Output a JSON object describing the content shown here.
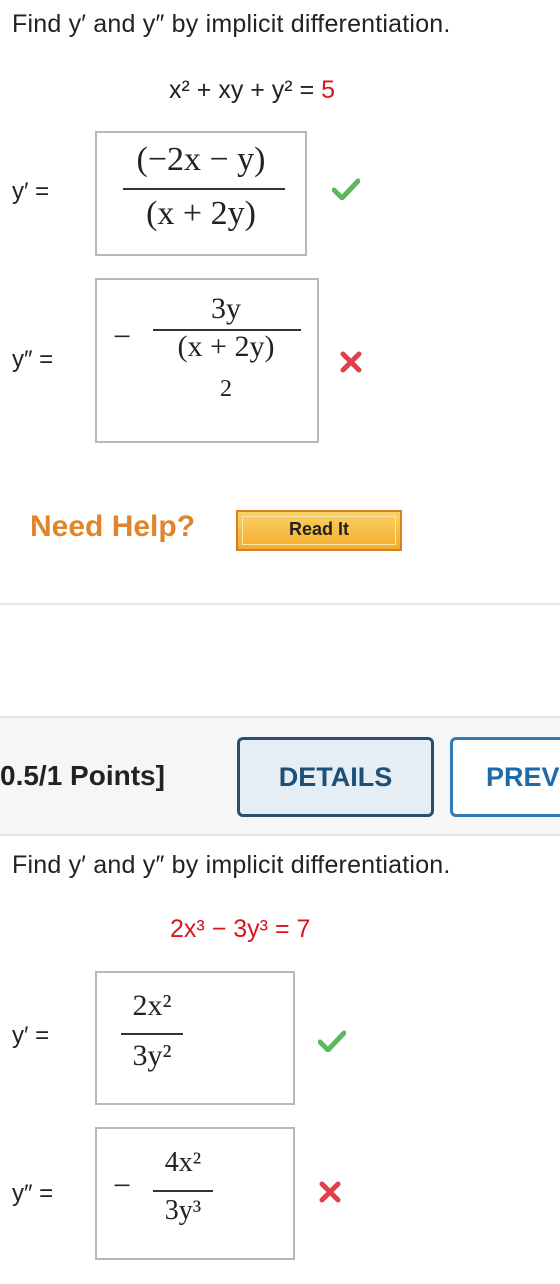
{
  "q1": {
    "prompt": "Find y′ and y″ by implicit differentiation.",
    "equation": {
      "lhs": "x² + xy + y²",
      "eq": "=",
      "rhs": "5"
    },
    "y1": {
      "label": "y′ =",
      "numerator": "(−2x − y)",
      "denominator": "(x + 2y)",
      "status": "correct"
    },
    "y2": {
      "label": "y″ =",
      "sign": "−",
      "numerator": "3y",
      "denominator": "(x + 2y)",
      "below": "2",
      "status": "incorrect"
    }
  },
  "help": {
    "label": "Need Help?",
    "read_it": "Read It"
  },
  "q2_header": {
    "points": "0.5/1 Points]",
    "details_button": "DETAILS",
    "prev_button": "PREV"
  },
  "q2": {
    "prompt": "Find y′ and y″ by implicit differentiation.",
    "equation": {
      "t1": "2x³",
      "op": "−",
      "t2": "3y³",
      "eq": "=",
      "rhs": "7"
    },
    "y1": {
      "label": "y′ =",
      "numerator": "2x²",
      "denominator": "3y²",
      "status": "correct"
    },
    "y2": {
      "label": "y″ =",
      "sign": "−",
      "numerator": "4x²",
      "denominator": "3y³",
      "status": "incorrect"
    }
  },
  "colors": {
    "given_value": "#d9161c",
    "check": "#5cb85c",
    "cross": "#e0404a",
    "help_text": "#e0852b",
    "details_border": "#2c4e6c",
    "prev_border": "#2f7cb8"
  },
  "icons": {
    "correct": "check-icon",
    "incorrect": "cross-icon"
  }
}
